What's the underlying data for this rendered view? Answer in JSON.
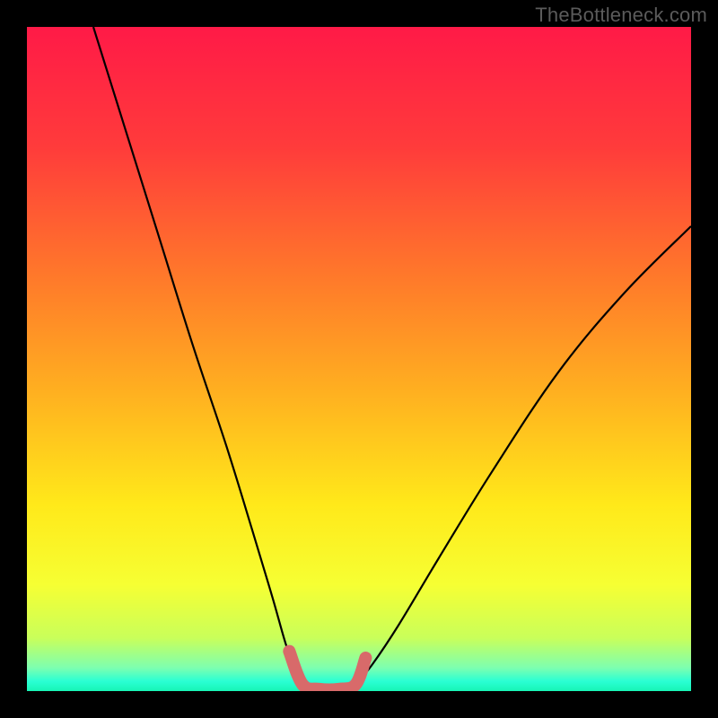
{
  "watermark": "TheBottleneck.com",
  "colors": {
    "frame": "#000000",
    "watermark": "#5b5b5b",
    "curve_main": "#000000",
    "curve_highlight": "#d86a6a",
    "gradient_stops": [
      {
        "offset": 0.0,
        "hex": "#ff1a47"
      },
      {
        "offset": 0.18,
        "hex": "#ff3b3b"
      },
      {
        "offset": 0.38,
        "hex": "#ff7a2a"
      },
      {
        "offset": 0.55,
        "hex": "#ffb020"
      },
      {
        "offset": 0.72,
        "hex": "#ffe91a"
      },
      {
        "offset": 0.84,
        "hex": "#f6ff33"
      },
      {
        "offset": 0.92,
        "hex": "#c9ff5a"
      },
      {
        "offset": 0.965,
        "hex": "#7dffb0"
      },
      {
        "offset": 0.985,
        "hex": "#2bffd4"
      },
      {
        "offset": 1.0,
        "hex": "#17f5b5"
      }
    ]
  },
  "chart_data": {
    "type": "line",
    "title": "",
    "xlabel": "",
    "ylabel": "",
    "xlim": [
      0,
      100
    ],
    "ylim": [
      0,
      100
    ],
    "series": [
      {
        "name": "left-curve",
        "x": [
          10,
          15,
          20,
          25,
          30,
          34,
          37,
          39,
          40.5,
          41.5
        ],
        "y": [
          100,
          84,
          68,
          52,
          37,
          24,
          14,
          7,
          3,
          1
        ]
      },
      {
        "name": "bottom-segment",
        "x": [
          41.5,
          44,
          47,
          49.5
        ],
        "y": [
          1,
          0.3,
          0.3,
          1
        ]
      },
      {
        "name": "right-curve",
        "x": [
          49.5,
          52,
          56,
          62,
          70,
          80,
          90,
          100
        ],
        "y": [
          1,
          4,
          10,
          20,
          33,
          48,
          60,
          70
        ]
      }
    ],
    "highlight": {
      "name": "bottom-highlight",
      "x": [
        39.5,
        41.5,
        44,
        47,
        49.5,
        51
      ],
      "y": [
        6,
        1,
        0.3,
        0.3,
        1,
        5
      ]
    }
  }
}
